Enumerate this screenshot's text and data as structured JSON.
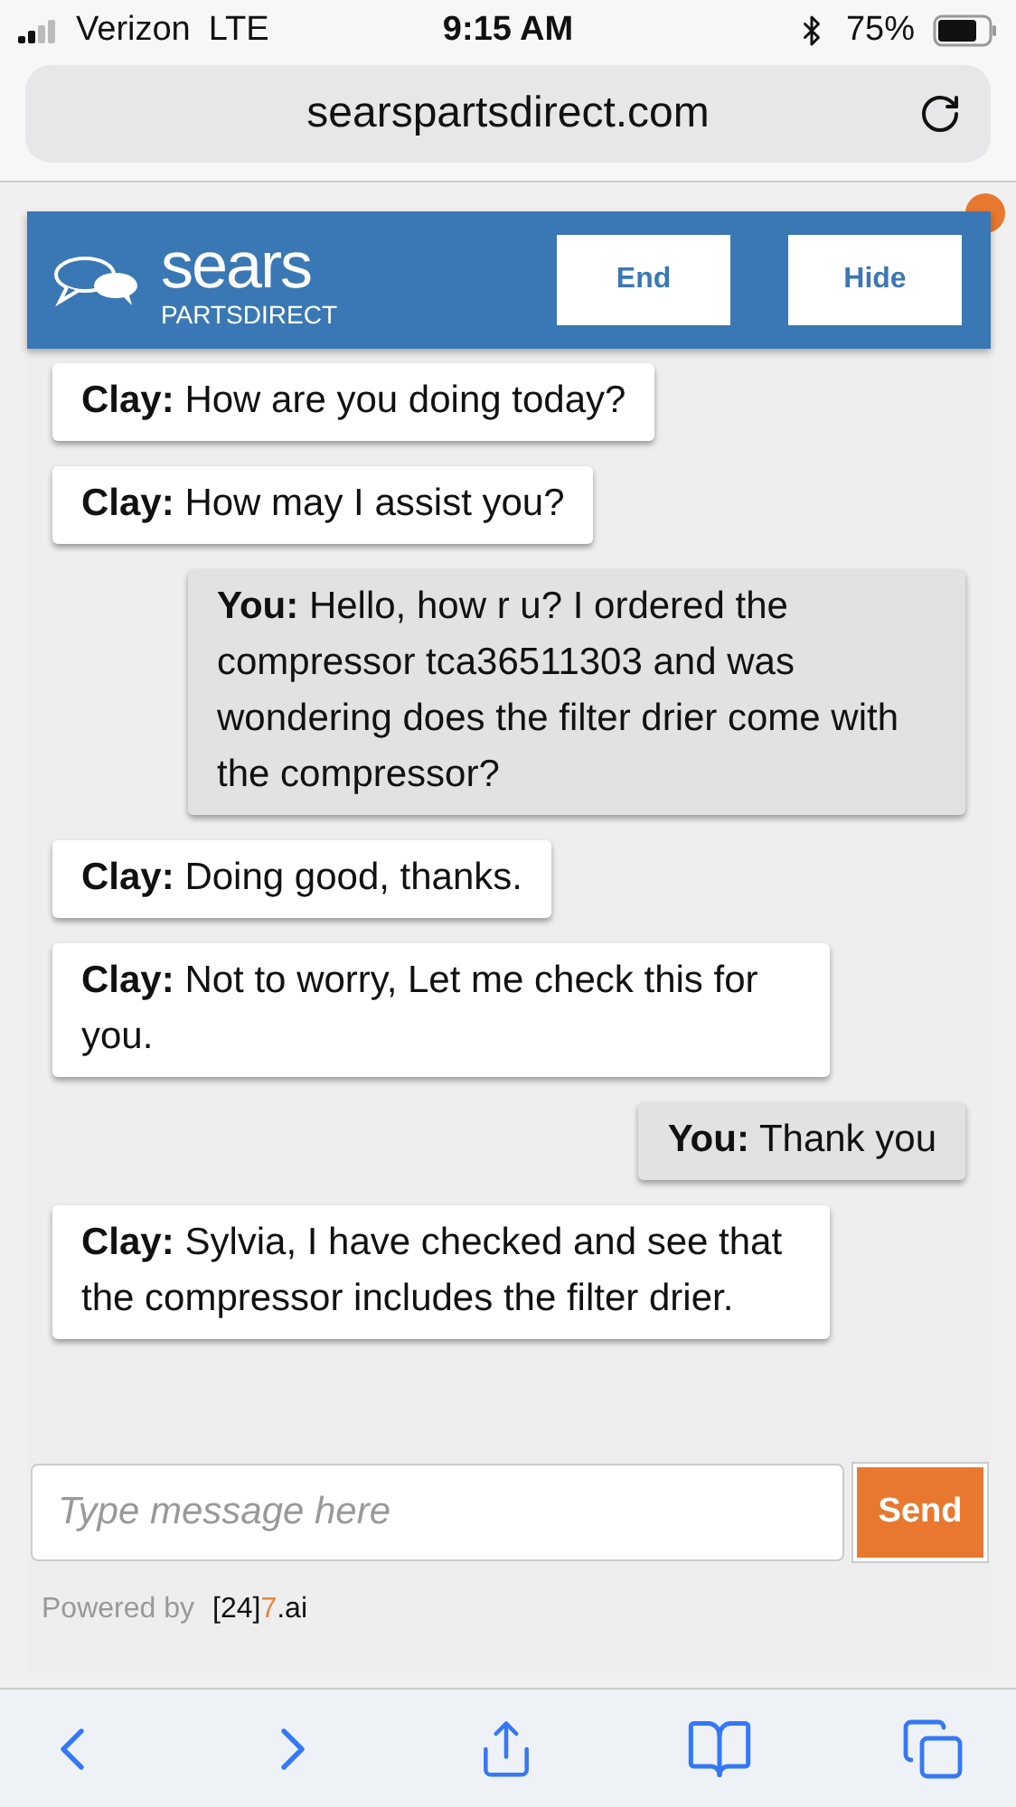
{
  "status_bar": {
    "carrier": "Verizon",
    "network": "LTE",
    "time": "9:15 AM",
    "battery": "75%"
  },
  "address_bar": {
    "url": "searspartsdirect.com"
  },
  "chat": {
    "brand": "sears",
    "brand_sub": "PARTSDIRECT",
    "buttons": [
      "End",
      "Hide"
    ],
    "messages": [
      {
        "kind": "agent",
        "sender": "Clay:",
        "text": "How are you doing today?"
      },
      {
        "kind": "agent",
        "sender": "Clay:",
        "text": "How may I assist you?"
      },
      {
        "kind": "you",
        "sender": "You:",
        "text": "Hello, how r u? I ordered the compressor tca36511303 and was wondering does the filter drier come with the compressor?"
      },
      {
        "kind": "agent",
        "sender": "Clay:",
        "text": "Doing good, thanks."
      },
      {
        "kind": "agent",
        "sender": "Clay:",
        "text": "Not to worry, Let me check this for you."
      },
      {
        "kind": "you",
        "sender": "You:",
        "text": "Thank you"
      },
      {
        "kind": "agent",
        "sender": "Clay:",
        "text": "Sylvia, I have checked and see that the compressor includes the filter drier."
      }
    ],
    "input": {
      "placeholder": "Type message here"
    },
    "send": "Send",
    "powered_by": "Powered by",
    "provider": [
      {
        "text": "[24]",
        "accent": false
      },
      {
        "text": "7",
        "accent": true
      },
      {
        "text": ".ai",
        "accent": false
      }
    ]
  }
}
